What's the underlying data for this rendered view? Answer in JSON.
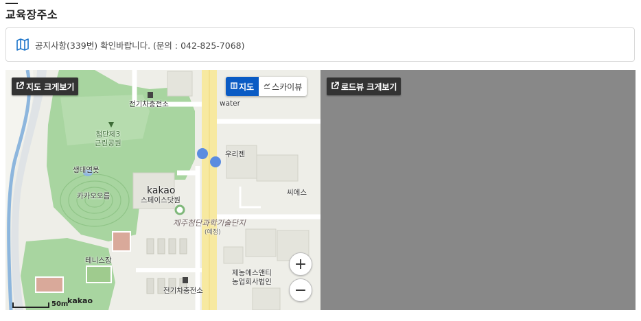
{
  "section": {
    "title": "교육장주소"
  },
  "notice": {
    "text": "공지사항(339번) 확인바랍니다. (문의 : 042-825-7068)",
    "icon": "map-icon"
  },
  "map": {
    "large_view_label": "지도 크게보기",
    "map_type": {
      "map_label": "지도",
      "skyview_label": "스카이뷰"
    },
    "zoom_in": "+",
    "zoom_out": "−",
    "scale": "50m",
    "brand": "kakao",
    "labels": {
      "ev_station_top": "전기차충전소",
      "water": "water",
      "park": "첨단제3\n근린공원",
      "ecopond": "생태연못",
      "kakao_oreum": "카카오오름",
      "kakao": "kakao",
      "space_dotwon": "스페이스닷원",
      "urijen": "우리젠",
      "sees": "씨에스",
      "complex": "제주첨단과학기술단지",
      "planned": "(예정)",
      "tennis": "테니스장",
      "nongup": "제농에스앤티\n농업회사법인",
      "ev_station_bottom": "전기차충전소"
    }
  },
  "roadview": {
    "large_view_label": "로드뷰 크게보기"
  },
  "colors": {
    "accent_blue": "#0a5bc4",
    "road_yellow": "#f7e9a0",
    "park_green": "#a8d5a0",
    "water_blue": "#8db6dd",
    "roadview_gray": "#888888"
  }
}
